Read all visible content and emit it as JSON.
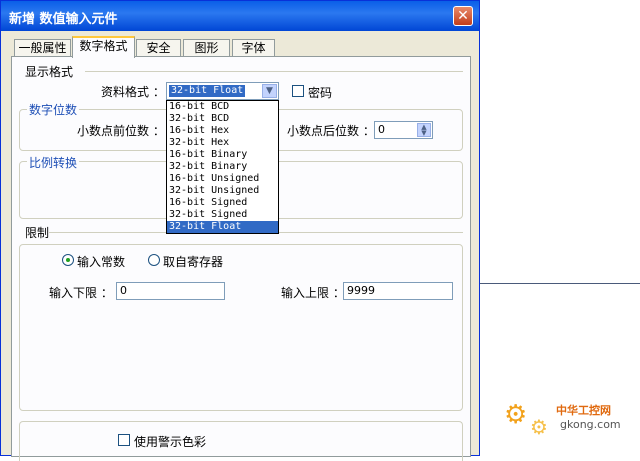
{
  "window": {
    "title": "新增  数值输入元件",
    "close_glyph": "✕"
  },
  "tabs": [
    {
      "label": "一般属性",
      "active": false
    },
    {
      "label": "数字格式",
      "active": true
    },
    {
      "label": "安全",
      "active": false
    },
    {
      "label": "图形",
      "active": false
    },
    {
      "label": "字体",
      "active": false
    }
  ],
  "display_format": {
    "section_label": "显示格式",
    "data_format_label": "资料格式 ：",
    "data_format_value": "32-bit Float",
    "password_label": "密码",
    "password_checked": false
  },
  "digits": {
    "section_label": "数字位数",
    "before_decimal_label": "小数点前位数 ：",
    "after_decimal_label": "小数点后位数 ：",
    "after_decimal_value": "0"
  },
  "scaling": {
    "section_label": "比例转换"
  },
  "dropdown": {
    "options": [
      "16-bit BCD",
      "32-bit BCD",
      "16-bit Hex",
      "32-bit Hex",
      "16-bit Binary",
      "32-bit Binary",
      "16-bit Unsigned",
      "32-bit Unsigned",
      "16-bit Signed",
      "32-bit Signed",
      "32-bit Float"
    ],
    "selected": "32-bit Float"
  },
  "limits": {
    "section_label": "限制",
    "radio_constant": "输入常数",
    "radio_register": "取自寄存器",
    "selected_radio": "constant",
    "lower_label": "输入下限 ：",
    "lower_value": "0",
    "upper_label": "输入上限 ：",
    "upper_value": "9999"
  },
  "warning": {
    "label": "使用警示色彩",
    "checked": false
  },
  "watermark": {
    "cn": "中华工控网",
    "en": "gkong.com"
  },
  "colors": {
    "title_bar": "#0a5fe8",
    "selection": "#316ac5",
    "dialog_bg": "#ece9d8"
  }
}
